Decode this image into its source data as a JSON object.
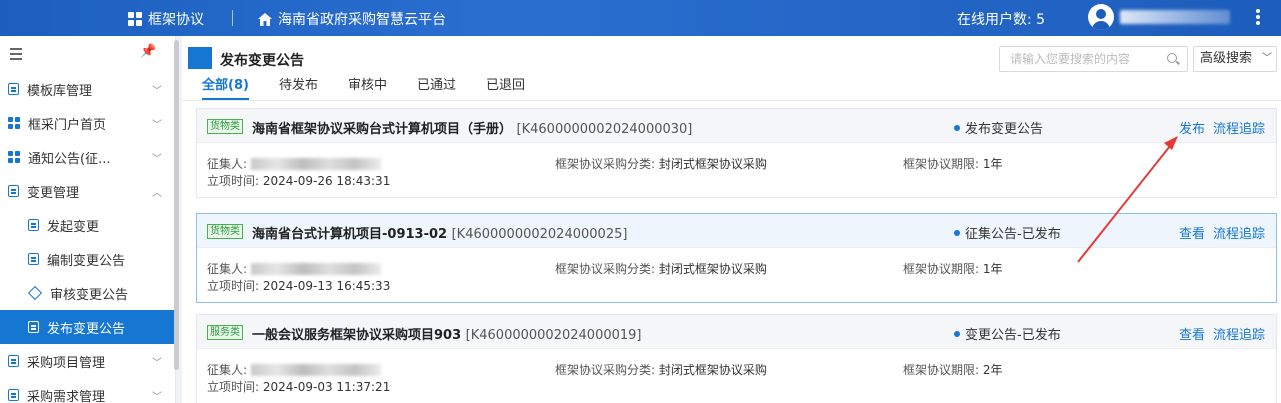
{
  "header": {
    "brand": "框架协议",
    "platform": "海南省政府采购智慧云平台",
    "online_label": "在线用户数:",
    "online_count": "5"
  },
  "sidebar": {
    "items": [
      {
        "label": "模板库管理",
        "icon": "doc-icon",
        "expanded": false
      },
      {
        "label": "框采门户首页",
        "icon": "grid-icon",
        "expanded": false
      },
      {
        "label": "通知公告(征...",
        "icon": "grid-icon",
        "expanded": false
      },
      {
        "label": "变更管理",
        "icon": "doc-icon",
        "expanded": true
      },
      {
        "label": "发起变更",
        "icon": "doc-icon",
        "sub": true
      },
      {
        "label": "编制变更公告",
        "icon": "doc-icon",
        "sub": true
      },
      {
        "label": "审核变更公告",
        "icon": "diamond-icon",
        "sub": true
      },
      {
        "label": "发布变更公告",
        "icon": "doc-icon",
        "sub": true,
        "active": true
      },
      {
        "label": "采购项目管理",
        "icon": "doc-icon",
        "expanded": false
      },
      {
        "label": "采购需求管理",
        "icon": "doc-icon",
        "expanded": false
      }
    ]
  },
  "main": {
    "title": "发布变更公告",
    "search_placeholder": "请输入您要搜索的内容",
    "advanced_search": "高级搜索",
    "tabs": [
      "全部(8)",
      "待发布",
      "审核中",
      "已通过",
      "已退回"
    ],
    "active_tab": "全部(8)"
  },
  "labels": {
    "collector": "征集人:",
    "created": "立项时间:",
    "category": "框架协议采购分类:",
    "term": "框架协议期限:"
  },
  "cards": [
    {
      "tag": "货物类",
      "name": "海南省框架协议采购台式计算机项目（手册）",
      "code": "[K4600000002024000030]",
      "status": "发布变更公告",
      "action1": "发布",
      "action2": "流程追踪",
      "created": "2024-09-26 18:43:31",
      "category": "封闭式框架协议采购",
      "term": "1年"
    },
    {
      "tag": "货物类",
      "name": "海南省台式计算机项目-0913-02",
      "code": "[K4600000002024000025]",
      "status": "征集公告-已发布",
      "action1": "查看",
      "action2": "流程追踪",
      "created": "2024-09-13 16:45:33",
      "category": "封闭式框架协议采购",
      "term": "1年"
    },
    {
      "tag": "服务类",
      "name": "一般会议服务框架协议采购项目903",
      "code": "[K4600000002024000019]",
      "status": "变更公告-已发布",
      "action1": "查看",
      "action2": "流程追踪",
      "created": "2024-09-03 11:37:21",
      "category": "封闭式框架协议采购",
      "term": "2年"
    }
  ],
  "colors": {
    "primary": "#1677d2",
    "header_bg": "#1d5dbc",
    "annotation_arrow": "#e53935",
    "tag_green": "#2e9b3f"
  }
}
